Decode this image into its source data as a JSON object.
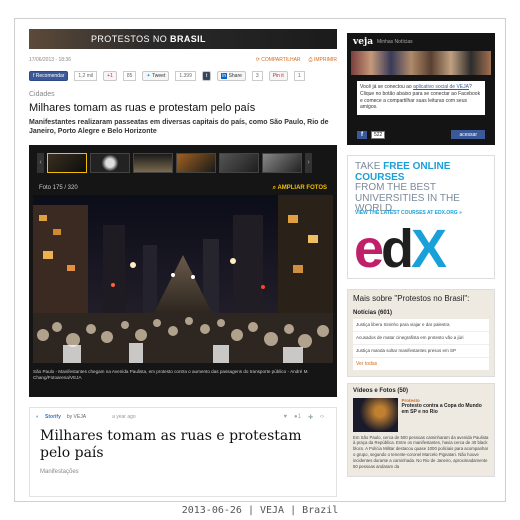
{
  "banner": {
    "title_pre": "PROTESTOS NO ",
    "title_bold": "BRASIL"
  },
  "meta": {
    "date": "17/06/2013 - 18:36",
    "share_label": "COMPARTILHAR",
    "print_label": "IMPRIMIR"
  },
  "share": {
    "facebook": {
      "label": "Recomendar",
      "count": "1,2 mil"
    },
    "gplus": {
      "label": "+1",
      "count": "85"
    },
    "twitter": {
      "label": "Tweet",
      "count": "1.399"
    },
    "tumblr": {
      "label": "t"
    },
    "linkedin": {
      "label": "Share",
      "count": "3"
    },
    "pinterest": {
      "label": "Pin it",
      "count": "1"
    }
  },
  "article": {
    "section": "Cidades",
    "title": "Milhares tomam as ruas e protestam pelo país",
    "subtitle": "Manifestantes realizaram passeatas em diversas capitais do país, como São Paulo, Rio de Janeiro, Porto Alegre e Belo Horizonte"
  },
  "gallery": {
    "photo_count": "Foto 175 / 320",
    "zoom_label": "AMPLIAR FOTOS",
    "caption": "São Paulo - Manifestantes chegam na Avenida Paulista, em protesto contra o aumento das passagens do transporte público - André M. Chang/Fotoarena/VEJA"
  },
  "storify": {
    "brand": "Storify",
    "by": "by VEJA",
    "ago": "a year ago",
    "title": "Milhares tomam as ruas e protestam pelo país",
    "category": "Manifestações"
  },
  "veja_box": {
    "logo": "veja",
    "subtitle": "Minhas Notícias",
    "message_pre": "Você já se conectou ao ",
    "message_link": "aplicativo social de VEJA",
    "message_post": "? Clique no botão abaixo para se conectar ao Facebook e comece a compartilhar suas leituras com seus amigos.",
    "count": "522",
    "access_label": "acessar"
  },
  "ad": {
    "line1_pre": "TAKE ",
    "line1_bold": "FREE ONLINE COURSES",
    "line2": "FROM THE BEST UNIVERSITIES IN THE WORLD.",
    "link": "VIEW THE LATEST COURSES AT EDX.ORG »",
    "logo_e": "e",
    "logo_d": "d",
    "logo_x": "X"
  },
  "more": {
    "title": "Mais sobre \"Protestos no Brasil\":",
    "news_title": "Notícias (601)",
    "news": [
      "Justiça libera Sininho para viajar e dar palestra",
      "Acusados de matar cinegrafista em protesto vão a júri",
      "Justiça manda soltar manifestantes presos em SP"
    ],
    "news_more": "Ver todas"
  },
  "videos": {
    "title": "Vídeos e Fotos (50)",
    "tag": "Protesto",
    "headline": "Protesto contra a Copa do Mundo em SP e no Rio",
    "desc": "Em São Paulo, cerca de 500 pessoas caminharam da avenida Paulista à praça da República. Entre os manifestantes, havia cerca de 40 black blocs. A Polícia Militar destacou quase 1000 policiais para acompanhar o grupo, segundo o tenente-coronel Marcelo Pignatari. Não houve incidentes durante a caminhada. No Rio de Janeiro, aproximadamente 50 pessoas andaram da"
  },
  "caption": "2013-06-26 | VEJA | Brazil"
}
